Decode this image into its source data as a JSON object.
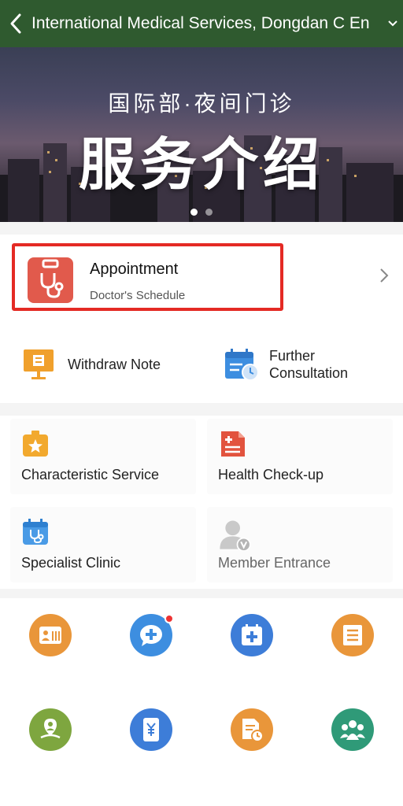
{
  "header": {
    "title": "International Medical Services, Dongdan C En"
  },
  "banner": {
    "subtitle": "国际部·夜间门诊",
    "title": "服务介绍",
    "slides": 2,
    "active_slide": 1
  },
  "appointment": {
    "title": "Appointment",
    "subtitle": "Doctor's Schedule",
    "icon": "stethoscope-bag-icon"
  },
  "quick_actions": [
    {
      "label": "Withdraw Note",
      "icon": "easel-note-icon"
    },
    {
      "label": "Further Consultation",
      "icon": "calendar-clock-icon"
    }
  ],
  "cards": [
    {
      "label": "Characteristic Service",
      "icon": "star-bag-icon"
    },
    {
      "label": "Health Check-up",
      "icon": "medical-report-icon"
    },
    {
      "label": "Specialist Clinic",
      "icon": "stethoscope-calendar-icon"
    },
    {
      "label": "Member Entrance",
      "icon": "vip-member-icon"
    }
  ],
  "round_icons": [
    {
      "icon": "id-card-icon",
      "color": "#e9963a"
    },
    {
      "icon": "chat-plus-icon",
      "color": "#3d8ee0",
      "badge": true
    },
    {
      "icon": "medical-box-icon",
      "color": "#3d7dd8"
    },
    {
      "icon": "receipt-icon",
      "color": "#e9963a"
    },
    {
      "icon": "location-person-icon",
      "color": "#7ea63f"
    },
    {
      "icon": "yen-phone-icon",
      "color": "#3d7dd8"
    },
    {
      "icon": "document-clock-icon",
      "color": "#e9963a"
    },
    {
      "icon": "group-icon",
      "color": "#2f9a78"
    }
  ],
  "colors": {
    "header_bg": "#2f5a2f",
    "highlight_border": "#e42a24"
  }
}
